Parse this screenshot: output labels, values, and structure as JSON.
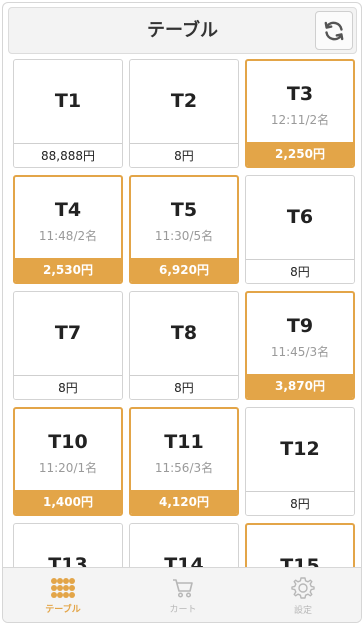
{
  "header": {
    "title": "テーブル"
  },
  "tables": [
    {
      "name": "T1",
      "sub": "",
      "price": "88,888円",
      "active": false
    },
    {
      "name": "T2",
      "sub": "",
      "price": "8円",
      "active": false
    },
    {
      "name": "T3",
      "sub": "12:11/2名",
      "price": "2,250円",
      "active": true
    },
    {
      "name": "T4",
      "sub": "11:48/2名",
      "price": "2,530円",
      "active": true
    },
    {
      "name": "T5",
      "sub": "11:30/5名",
      "price": "6,920円",
      "active": true
    },
    {
      "name": "T6",
      "sub": "",
      "price": "8円",
      "active": false
    },
    {
      "name": "T7",
      "sub": "",
      "price": "8円",
      "active": false
    },
    {
      "name": "T8",
      "sub": "",
      "price": "8円",
      "active": false
    },
    {
      "name": "T9",
      "sub": "11:45/3名",
      "price": "3,870円",
      "active": true
    },
    {
      "name": "T10",
      "sub": "11:20/1名",
      "price": "1,400円",
      "active": true
    },
    {
      "name": "T11",
      "sub": "11:56/3名",
      "price": "4,120円",
      "active": true
    },
    {
      "name": "T12",
      "sub": "",
      "price": "8円",
      "active": false
    },
    {
      "name": "T13",
      "sub": "",
      "price": "",
      "active": false
    },
    {
      "name": "T14",
      "sub": "",
      "price": "",
      "active": false
    },
    {
      "name": "T15",
      "sub": "",
      "price": "",
      "active": true
    }
  ],
  "tabbar": {
    "items": [
      {
        "label": "テーブル",
        "icon": "grid-icon",
        "active": true
      },
      {
        "label": "カート",
        "icon": "cart-icon",
        "active": false
      },
      {
        "label": "設定",
        "icon": "gear-icon",
        "active": false
      }
    ]
  },
  "colors": {
    "accent": "#e3a548",
    "border": "#d3d3d3",
    "muted": "#b7b7b7"
  }
}
